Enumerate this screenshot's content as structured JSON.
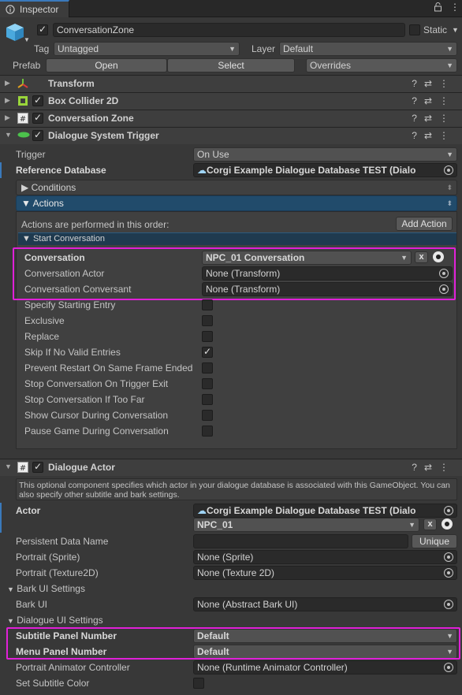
{
  "window": {
    "tab_title": "Inspector"
  },
  "gameobject": {
    "name": "ConversationZone",
    "static_label": "Static",
    "tag_label": "Tag",
    "tag_value": "Untagged",
    "layer_label": "Layer",
    "layer_value": "Default",
    "prefab_label": "Prefab",
    "open_label": "Open",
    "select_label": "Select",
    "overrides_label": "Overrides"
  },
  "components": [
    {
      "name": "Transform"
    },
    {
      "name": "Box Collider 2D"
    },
    {
      "name": "Conversation Zone"
    },
    {
      "name": "Dialogue System Trigger"
    },
    {
      "name": "Dialogue Actor"
    }
  ],
  "trigger": {
    "trigger_label": "Trigger",
    "trigger_value": "On Use",
    "ref_db_label": "Reference Database",
    "ref_db_value": "Corgi Example Dialogue Database TEST (Dialo",
    "conditions_label": "Conditions",
    "actions_label": "Actions",
    "actions_info": "Actions are performed in this order:",
    "add_action_label": "Add Action",
    "start_conversation_label": "Start Conversation",
    "conversation_label": "Conversation",
    "conversation_value": "NPC_01 Conversation",
    "clear_label": "x",
    "conversation_actor_label": "Conversation Actor",
    "conversation_actor_value": "None (Transform)",
    "conversation_conversant_label": "Conversation Conversant",
    "conversation_conversant_value": "None (Transform)",
    "options": [
      {
        "label": "Specify Starting Entry",
        "checked": false
      },
      {
        "label": "Exclusive",
        "checked": false
      },
      {
        "label": "Replace",
        "checked": false
      },
      {
        "label": "Skip If No Valid Entries",
        "checked": true
      },
      {
        "label": "Prevent Restart On Same Frame Ended",
        "checked": false
      },
      {
        "label": "Stop Conversation On Trigger Exit",
        "checked": false
      },
      {
        "label": "Stop Conversation If Too Far",
        "checked": false
      },
      {
        "label": "Show Cursor During Conversation",
        "checked": false
      },
      {
        "label": "Pause Game During Conversation",
        "checked": false
      }
    ]
  },
  "actor": {
    "help_text": "This optional component specifies which actor in your dialogue database is associated with this GameObject. You can also specify other subtitle and bark settings.",
    "actor_label": "Actor",
    "actor_db_value": "Corgi Example Dialogue Database TEST (Dialo",
    "actor_value": "NPC_01",
    "clear_label": "x",
    "persistent_label": "Persistent Data Name",
    "persistent_value": "",
    "unique_label": "Unique",
    "portrait_sprite_label": "Portrait (Sprite)",
    "portrait_sprite_value": "None (Sprite)",
    "portrait_tex_label": "Portrait (Texture2D)",
    "portrait_tex_value": "None (Texture 2D)",
    "bark_ui_settings_label": "Bark UI Settings",
    "bark_ui_label": "Bark UI",
    "bark_ui_value": "None (Abstract Bark UI)",
    "dialogue_ui_settings_label": "Dialogue UI Settings",
    "subtitle_panel_label": "Subtitle Panel Number",
    "subtitle_panel_value": "Default",
    "menu_panel_label": "Menu Panel Number",
    "menu_panel_value": "Default",
    "portrait_anim_label": "Portrait Animator Controller",
    "portrait_anim_value": "None (Runtime Animator Controller)",
    "set_subtitle_color_label": "Set Subtitle Color",
    "set_subtitle_color_checked": false
  },
  "colors": {
    "highlight": "#e020d8",
    "accent": "#3a79bb",
    "actions_bar": "#214b6b"
  }
}
